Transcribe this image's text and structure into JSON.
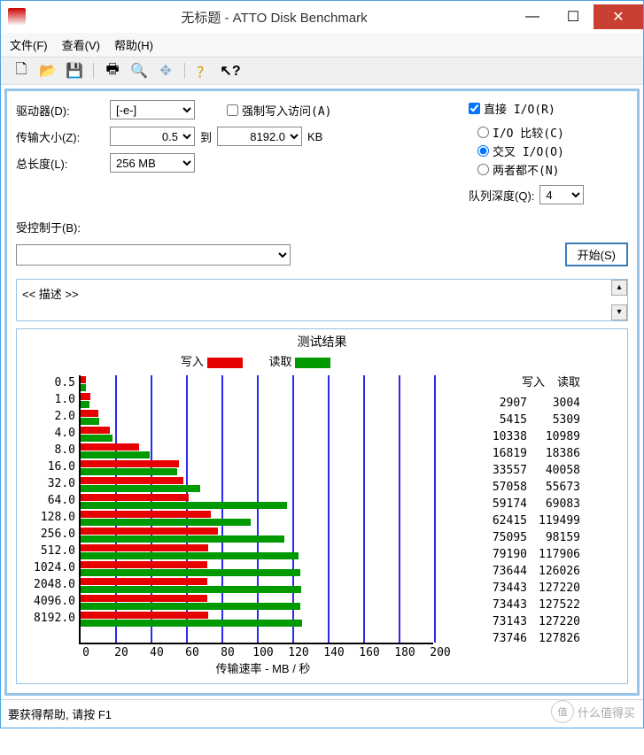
{
  "window": {
    "title": "无标题 - ATTO Disk Benchmark"
  },
  "menu": {
    "file": "文件(F)",
    "view": "查看(V)",
    "help": "帮助(H)"
  },
  "controls": {
    "drive_label": "驱动器(D):",
    "drive_value": "[-e-]",
    "transfer_label": "传输大小(Z):",
    "transfer_from": "0.5",
    "transfer_to_label": "到",
    "transfer_to": "8192.0",
    "transfer_unit": "KB",
    "length_label": "总长度(L):",
    "length_value": "256 MB",
    "force_write_label": "强制写入访问(A)",
    "direct_io_label": "直接 I/O(R)",
    "io_compare_label": "I/O 比较(C)",
    "overlap_io_label": "交叉 I/O(O)",
    "neither_label": "两者都不(N)",
    "queue_label": "队列深度(Q):",
    "queue_value": "4",
    "controlled_label": "受控制于(B):",
    "controlled_value": "",
    "start_button": "开始(S)",
    "description": "<< 描述 >>"
  },
  "chart_data": {
    "type": "bar",
    "title": "测试结果",
    "legend_write": "写入",
    "legend_read": "读取",
    "categories": [
      "0.5",
      "1.0",
      "2.0",
      "4.0",
      "8.0",
      "16.0",
      "32.0",
      "64.0",
      "128.0",
      "256.0",
      "512.0",
      "1024.0",
      "2048.0",
      "4096.0",
      "8192.0"
    ],
    "xlabel": "传输速率 - MB / 秒",
    "xticks": [
      0,
      20,
      40,
      60,
      80,
      100,
      120,
      140,
      160,
      180,
      200
    ],
    "xlim": [
      0,
      200
    ],
    "write_kb": [
      2907,
      5415,
      10338,
      16819,
      33557,
      57058,
      59174,
      62415,
      75095,
      79190,
      73644,
      73443,
      73443,
      73143,
      73746
    ],
    "read_kb": [
      3004,
      5309,
      10989,
      18386,
      40058,
      55673,
      69083,
      119499,
      98159,
      117906,
      126026,
      127220,
      127522,
      127220,
      127826
    ],
    "write_mb": [
      2.8,
      5.3,
      10.1,
      16.4,
      32.8,
      55.7,
      57.8,
      61.0,
      73.3,
      77.3,
      71.9,
      71.7,
      71.7,
      71.4,
      72.0
    ],
    "read_mb": [
      2.9,
      5.2,
      10.7,
      18.0,
      39.1,
      54.4,
      67.5,
      116.7,
      95.9,
      115.1,
      123.1,
      124.2,
      124.5,
      124.2,
      124.8
    ],
    "table_headers": {
      "write": "写入",
      "read": "读取"
    }
  },
  "statusbar": {
    "help_text": "要获得帮助, 请按 F1"
  },
  "watermark": {
    "badge": "值",
    "text": "什么值得买"
  }
}
